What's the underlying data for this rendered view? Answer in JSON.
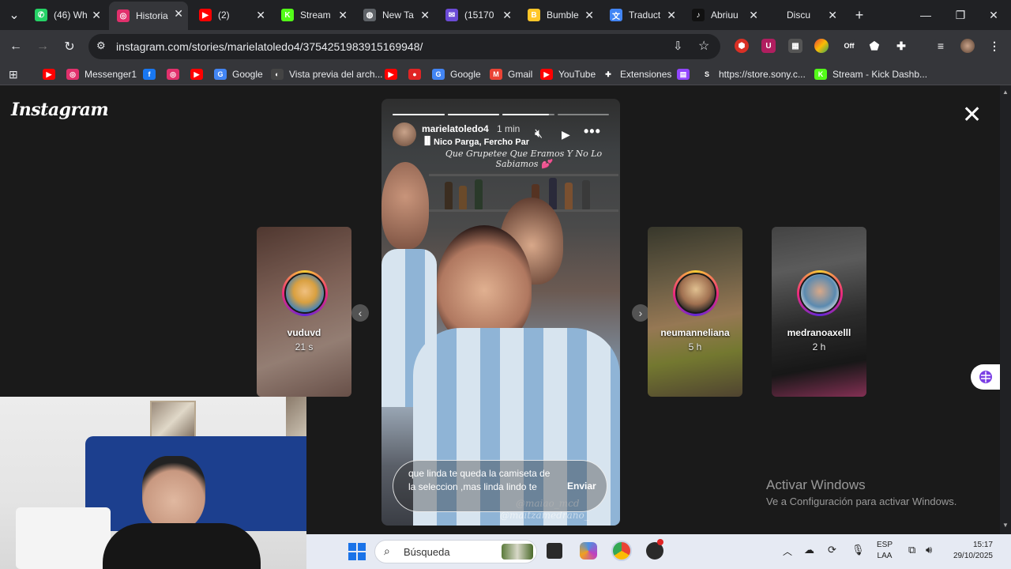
{
  "browser": {
    "tabs": [
      {
        "title": "(46) Wh",
        "icon": "whatsapp-icon",
        "color": "#25d366",
        "glyph": "✆"
      },
      {
        "title": "Historia",
        "icon": "instagram-icon",
        "color": "#e1306c",
        "glyph": "◎"
      },
      {
        "title": "(2) ",
        "icon": "youtube-icon",
        "color": "#ff0000",
        "glyph": "▶"
      },
      {
        "title": "Stream",
        "icon": "kick-icon",
        "color": "#53fc18",
        "glyph": "K"
      },
      {
        "title": "New Ta",
        "icon": "chrome-icon",
        "color": "#5f6368",
        "glyph": "◍"
      },
      {
        "title": "(15170",
        "icon": "mail-icon",
        "color": "#6b4bd6",
        "glyph": "✉"
      },
      {
        "title": "Bumble",
        "icon": "bumble-icon",
        "color": "#ffc629",
        "glyph": "B"
      },
      {
        "title": "Traduct",
        "icon": "translate-icon",
        "color": "#4285f4",
        "glyph": "文"
      },
      {
        "title": "Abriuu",
        "icon": "tiktok-icon",
        "color": "#111111",
        "glyph": "♪"
      },
      {
        "title": "Disculp",
        "icon": "blank-icon",
        "color": "#202124",
        "glyph": ""
      }
    ],
    "new_tab": "+",
    "url": "instagram.com/stories/marielatoledo4/3754251983915169948/",
    "bookmarks": [
      {
        "label": "",
        "icon": "youtube-icon",
        "color": "#ff0000",
        "glyph": "▶"
      },
      {
        "label": "Messenger1",
        "icon": "instagram-icon",
        "color": "#e1306c",
        "glyph": "◎"
      },
      {
        "label": "",
        "icon": "facebook-icon",
        "color": "#1877f2",
        "glyph": "f"
      },
      {
        "label": "",
        "icon": "instagram-icon",
        "color": "#e1306c",
        "glyph": "◎"
      },
      {
        "label": "",
        "icon": "youtube-icon",
        "color": "#ff0000",
        "glyph": "▶"
      },
      {
        "label": "Google",
        "icon": "google-icon",
        "color": "#4285f4",
        "glyph": "G"
      },
      {
        "label": "Vista previa del arch...",
        "icon": "preview-icon",
        "color": "#444",
        "glyph": "◐"
      },
      {
        "label": "",
        "icon": "youtube-icon",
        "color": "#ff0000",
        "glyph": "▶"
      },
      {
        "label": "",
        "icon": "red-app-icon",
        "color": "#e02424",
        "glyph": "●"
      },
      {
        "label": "Google",
        "icon": "google-icon",
        "color": "#4285f4",
        "glyph": "G"
      },
      {
        "label": "Gmail",
        "icon": "gmail-icon",
        "color": "#ea4335",
        "glyph": "M"
      },
      {
        "label": "YouTube",
        "icon": "youtube-icon",
        "color": "#ff0000",
        "glyph": "▶"
      },
      {
        "label": "Extensiones",
        "icon": "puzzle-icon",
        "color": "#35363a",
        "glyph": "✚"
      },
      {
        "label": "",
        "icon": "twitch-icon",
        "color": "#9146ff",
        "glyph": "▤"
      },
      {
        "label": "https://store.sony.c...",
        "icon": "sony-icon",
        "color": "#35363a",
        "glyph": "S"
      },
      {
        "label": "Stream - Kick Dashb...",
        "icon": "kick-icon",
        "color": "#53fc18",
        "glyph": "K"
      }
    ]
  },
  "instagram": {
    "logo": "Instagram",
    "story": {
      "username": "marielatoledo4",
      "time": "1 min",
      "music": "Nico Parga, Fercho Par",
      "caption": "Que Grupetee Que Eramos Y No Lo Sabiamos 💕",
      "progress": [
        1.0,
        1.0,
        0.9,
        0.0
      ],
      "reply_text": "que linda te queda la camiseta de la seleccion ,mas linda lindo te",
      "send_label": "Enviar",
      "watermark_1": "@maiao_mcd",
      "watermark_2": "@maitzamedrano_"
    },
    "side_stories": [
      {
        "username": "vuduvd",
        "time": "21 s"
      },
      {
        "username": "neumanneliana",
        "time": "5 h"
      },
      {
        "username": "medranoaxelll",
        "time": "2 h"
      }
    ]
  },
  "windows": {
    "activate_title": "Activar Windows",
    "activate_sub": "Ve a Configuración para activar Windows.",
    "search_placeholder": "Búsqueda",
    "lang_1": "ESP",
    "lang_2": "LAA",
    "time": "15:17",
    "date": "29/10/2025"
  }
}
